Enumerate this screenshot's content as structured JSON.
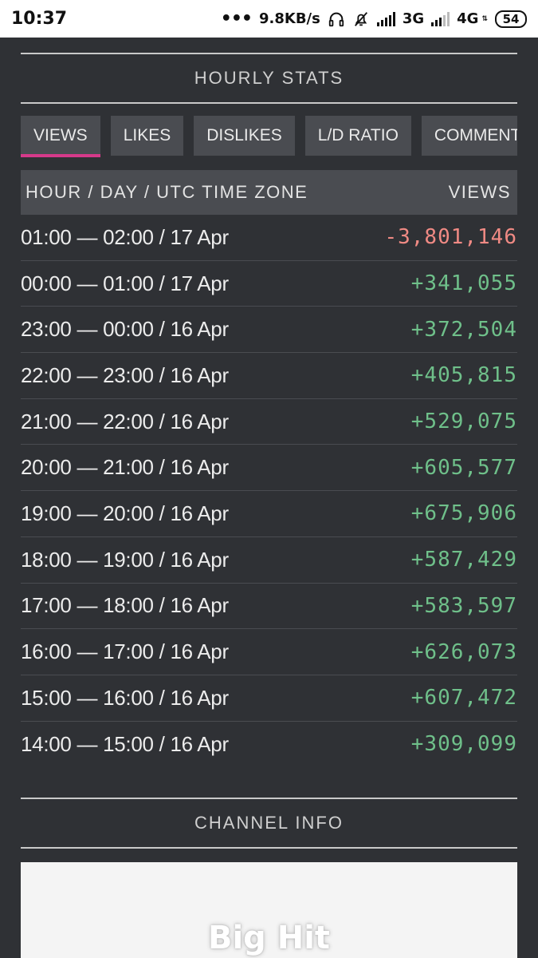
{
  "statusbar": {
    "time": "10:37",
    "dots": "•••",
    "speed": "9.8KB/s",
    "net1": "3G",
    "net2": "4G",
    "net2_small": "⇅",
    "battery": "54",
    "icons": [
      "headphones-icon",
      "mute-bell-icon",
      "signal-icon"
    ]
  },
  "hourly": {
    "title": "HOURLY STATS",
    "tabs": [
      "VIEWS",
      "LIKES",
      "DISLIKES",
      "L/D RATIO",
      "COMMENTS"
    ],
    "active_tab": "VIEWS",
    "accent": "#d63a8a",
    "header": {
      "left": "HOUR / DAY / UTC TIME ZONE",
      "right": "VIEWS"
    },
    "rows": [
      {
        "label": "01:00 — 02:00 / 17 Apr",
        "value": "-3,801,146"
      },
      {
        "label": "00:00 — 01:00 / 17 Apr",
        "value": "+341,055"
      },
      {
        "label": "23:00 — 00:00 / 16 Apr",
        "value": "+372,504"
      },
      {
        "label": "22:00 — 23:00 / 16 Apr",
        "value": "+405,815"
      },
      {
        "label": "21:00 — 22:00 / 16 Apr",
        "value": "+529,075"
      },
      {
        "label": "20:00 — 21:00 / 16 Apr",
        "value": "+605,577"
      },
      {
        "label": "19:00 — 20:00 / 16 Apr",
        "value": "+675,906"
      },
      {
        "label": "18:00 — 19:00 / 16 Apr",
        "value": "+587,429"
      },
      {
        "label": "17:00 — 18:00 / 16 Apr",
        "value": "+583,597"
      },
      {
        "label": "16:00 — 17:00 / 16 Apr",
        "value": "+626,073"
      },
      {
        "label": "15:00 — 16:00 / 16 Apr",
        "value": "+607,472"
      },
      {
        "label": "14:00 — 15:00 / 16 Apr",
        "value": "+309,099"
      }
    ],
    "colors": {
      "positive": "#6fc08a",
      "negative": "#f08a84"
    }
  },
  "channel": {
    "title": "CHANNEL INFO",
    "logo_text": "Big Hit"
  }
}
